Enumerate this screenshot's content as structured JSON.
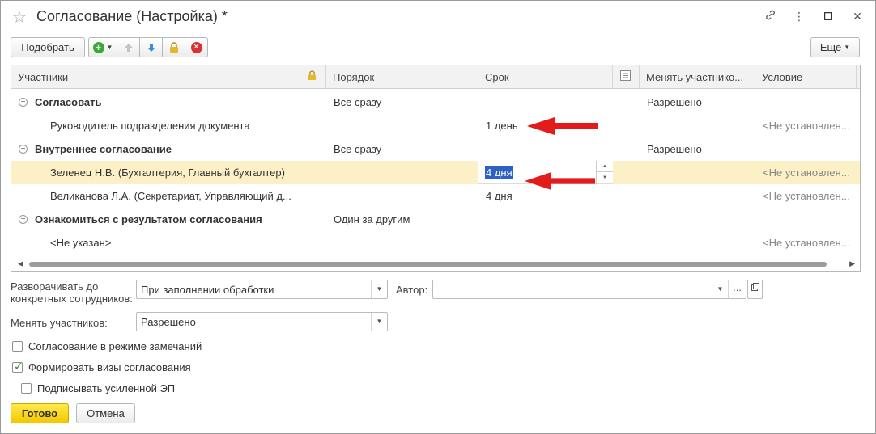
{
  "window": {
    "title": "Согласование (Настройка) *"
  },
  "toolbar": {
    "pick_label": "Подобрать",
    "more_label": "Еще"
  },
  "grid": {
    "columns": {
      "participants": "Участники",
      "order": "Порядок",
      "deadline": "Срок",
      "change_participants": "Менять участнико...",
      "condition": "Условие"
    },
    "rows": [
      {
        "participant": "Согласовать",
        "order": "Все сразу",
        "deadline": "",
        "change": "Разрешено",
        "condition": ""
      },
      {
        "participant": "Руководитель подразделения документа",
        "order": "",
        "deadline": "1 день",
        "change": "",
        "condition": "<Не установлен..."
      },
      {
        "participant": "Внутреннее согласование",
        "order": "Все сразу",
        "deadline": "",
        "change": "Разрешено",
        "condition": ""
      },
      {
        "participant": "Зеленец Н.В. (Бухгалтерия, Главный бухгалтер)",
        "order": "",
        "deadline": "4 дня",
        "change": "",
        "condition": "<Не установлен..."
      },
      {
        "participant": "Великанова Л.А. (Секретариат, Управляющий д...",
        "order": "",
        "deadline": "4 дня",
        "change": "",
        "condition": "<Не установлен..."
      },
      {
        "participant": "Ознакомиться с результатом согласования",
        "order": "Один за другим",
        "deadline": "",
        "change": "",
        "condition": ""
      },
      {
        "participant": "<Не указан>",
        "order": "",
        "deadline": "",
        "change": "",
        "condition": "<Не установлен..."
      }
    ]
  },
  "form": {
    "expand_label": "Разворачивать до конкретных сотрудников:",
    "expand_value": "При заполнении обработки",
    "author_label": "Автор:",
    "author_value": "",
    "change_label": "Менять участников:",
    "change_value": "Разрешено",
    "cb_remarks": {
      "label": "Согласование в режиме замечаний",
      "checked": false
    },
    "cb_visas": {
      "label": "Формировать визы согласования",
      "checked": true
    },
    "cb_sign": {
      "label": "Подписывать усиленной ЭП",
      "checked": false
    }
  },
  "footer": {
    "done_label": "Готово",
    "cancel_label": "Отмена"
  },
  "colors": {
    "accent_yellow": "#f4c800",
    "selected_row": "#fbf0c6",
    "annotation_arrow": "#e31b1b"
  }
}
